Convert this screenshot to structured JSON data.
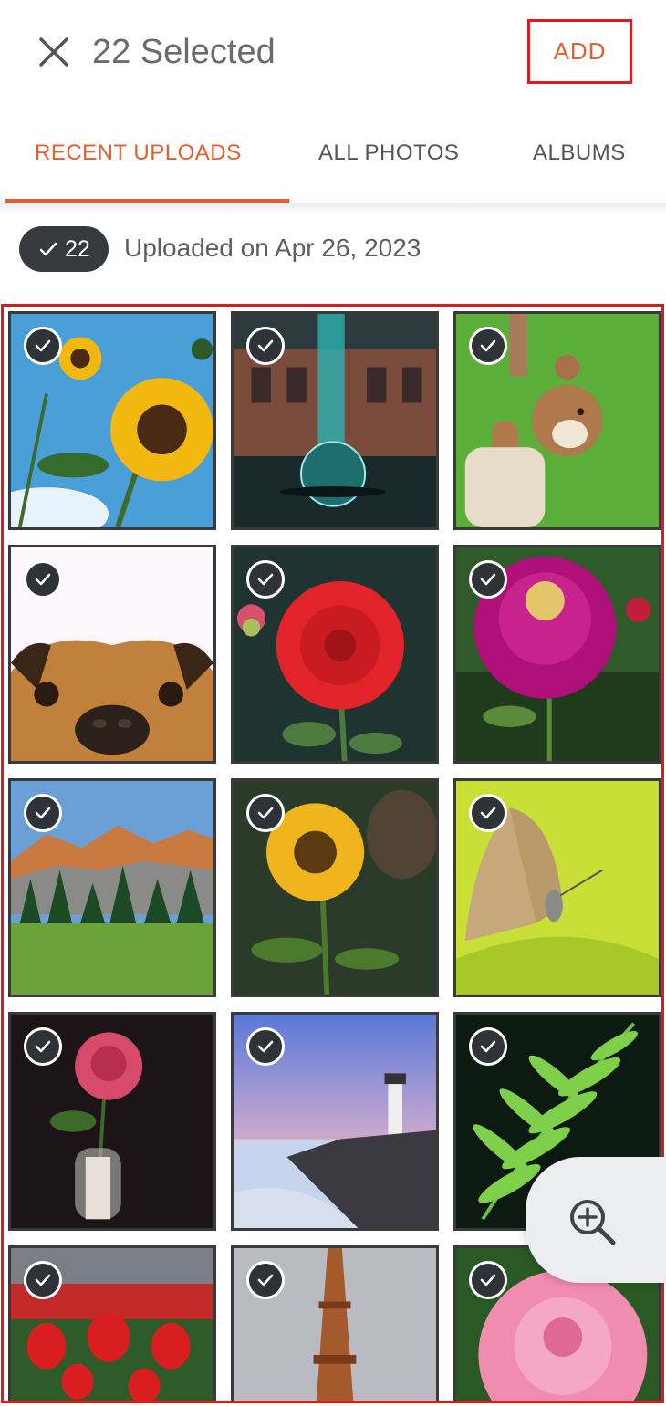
{
  "header": {
    "close_icon": "close-icon",
    "title": "22 Selected",
    "add_label": "ADD",
    "accent_color": "#e0602f",
    "highlight_color": "#d71d1d"
  },
  "tabs": [
    {
      "label": "RECENT UPLOADS",
      "active": true
    },
    {
      "label": "ALL PHOTOS",
      "active": false
    },
    {
      "label": "ALBUMS",
      "active": false
    }
  ],
  "group": {
    "count": "22",
    "label": "Uploaded on Apr 26, 2023"
  },
  "photos": [
    {
      "subject": "sunflower-sky",
      "selected": true
    },
    {
      "subject": "crystal-ball",
      "selected": true
    },
    {
      "subject": "teddy-bear",
      "selected": true
    },
    {
      "subject": "dog-peeking",
      "selected": true
    },
    {
      "subject": "red-dahlia",
      "selected": true
    },
    {
      "subject": "purple-dahlia",
      "selected": true
    },
    {
      "subject": "mountain-forest",
      "selected": true
    },
    {
      "subject": "sunflower-garden",
      "selected": true
    },
    {
      "subject": "butterfly",
      "selected": true
    },
    {
      "subject": "rose-vase",
      "selected": true
    },
    {
      "subject": "lighthouse",
      "selected": true
    },
    {
      "subject": "fern",
      "selected": true
    },
    {
      "subject": "red-tulips",
      "selected": true
    },
    {
      "subject": "eiffel-tower",
      "selected": true
    },
    {
      "subject": "pink-rose",
      "selected": true
    }
  ],
  "zoom_button_icon": "zoom-in-icon"
}
